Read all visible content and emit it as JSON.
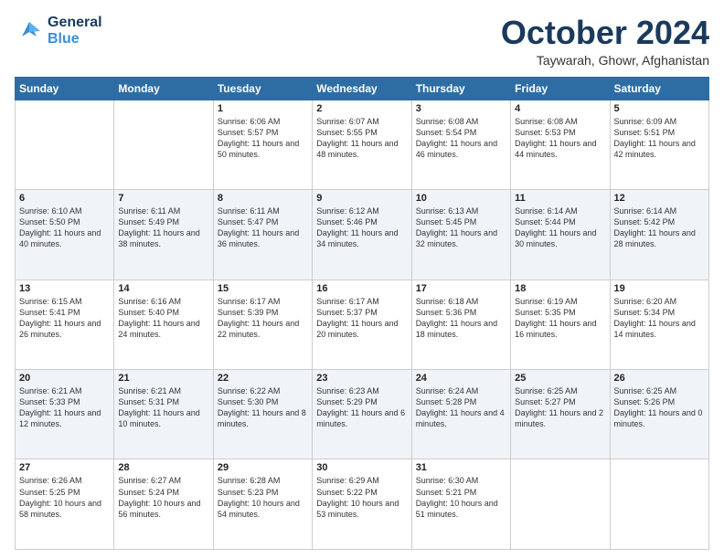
{
  "header": {
    "logo_line1": "General",
    "logo_line2": "Blue",
    "month_title": "October 2024",
    "location": "Taywarah, Ghowr, Afghanistan"
  },
  "days_of_week": [
    "Sunday",
    "Monday",
    "Tuesday",
    "Wednesday",
    "Thursday",
    "Friday",
    "Saturday"
  ],
  "weeks": [
    [
      {
        "day": "",
        "sunrise": "",
        "sunset": "",
        "daylight": ""
      },
      {
        "day": "",
        "sunrise": "",
        "sunset": "",
        "daylight": ""
      },
      {
        "day": "1",
        "sunrise": "Sunrise: 6:06 AM",
        "sunset": "Sunset: 5:57 PM",
        "daylight": "Daylight: 11 hours and 50 minutes."
      },
      {
        "day": "2",
        "sunrise": "Sunrise: 6:07 AM",
        "sunset": "Sunset: 5:55 PM",
        "daylight": "Daylight: 11 hours and 48 minutes."
      },
      {
        "day": "3",
        "sunrise": "Sunrise: 6:08 AM",
        "sunset": "Sunset: 5:54 PM",
        "daylight": "Daylight: 11 hours and 46 minutes."
      },
      {
        "day": "4",
        "sunrise": "Sunrise: 6:08 AM",
        "sunset": "Sunset: 5:53 PM",
        "daylight": "Daylight: 11 hours and 44 minutes."
      },
      {
        "day": "5",
        "sunrise": "Sunrise: 6:09 AM",
        "sunset": "Sunset: 5:51 PM",
        "daylight": "Daylight: 11 hours and 42 minutes."
      }
    ],
    [
      {
        "day": "6",
        "sunrise": "Sunrise: 6:10 AM",
        "sunset": "Sunset: 5:50 PM",
        "daylight": "Daylight: 11 hours and 40 minutes."
      },
      {
        "day": "7",
        "sunrise": "Sunrise: 6:11 AM",
        "sunset": "Sunset: 5:49 PM",
        "daylight": "Daylight: 11 hours and 38 minutes."
      },
      {
        "day": "8",
        "sunrise": "Sunrise: 6:11 AM",
        "sunset": "Sunset: 5:47 PM",
        "daylight": "Daylight: 11 hours and 36 minutes."
      },
      {
        "day": "9",
        "sunrise": "Sunrise: 6:12 AM",
        "sunset": "Sunset: 5:46 PM",
        "daylight": "Daylight: 11 hours and 34 minutes."
      },
      {
        "day": "10",
        "sunrise": "Sunrise: 6:13 AM",
        "sunset": "Sunset: 5:45 PM",
        "daylight": "Daylight: 11 hours and 32 minutes."
      },
      {
        "day": "11",
        "sunrise": "Sunrise: 6:14 AM",
        "sunset": "Sunset: 5:44 PM",
        "daylight": "Daylight: 11 hours and 30 minutes."
      },
      {
        "day": "12",
        "sunrise": "Sunrise: 6:14 AM",
        "sunset": "Sunset: 5:42 PM",
        "daylight": "Daylight: 11 hours and 28 minutes."
      }
    ],
    [
      {
        "day": "13",
        "sunrise": "Sunrise: 6:15 AM",
        "sunset": "Sunset: 5:41 PM",
        "daylight": "Daylight: 11 hours and 26 minutes."
      },
      {
        "day": "14",
        "sunrise": "Sunrise: 6:16 AM",
        "sunset": "Sunset: 5:40 PM",
        "daylight": "Daylight: 11 hours and 24 minutes."
      },
      {
        "day": "15",
        "sunrise": "Sunrise: 6:17 AM",
        "sunset": "Sunset: 5:39 PM",
        "daylight": "Daylight: 11 hours and 22 minutes."
      },
      {
        "day": "16",
        "sunrise": "Sunrise: 6:17 AM",
        "sunset": "Sunset: 5:37 PM",
        "daylight": "Daylight: 11 hours and 20 minutes."
      },
      {
        "day": "17",
        "sunrise": "Sunrise: 6:18 AM",
        "sunset": "Sunset: 5:36 PM",
        "daylight": "Daylight: 11 hours and 18 minutes."
      },
      {
        "day": "18",
        "sunrise": "Sunrise: 6:19 AM",
        "sunset": "Sunset: 5:35 PM",
        "daylight": "Daylight: 11 hours and 16 minutes."
      },
      {
        "day": "19",
        "sunrise": "Sunrise: 6:20 AM",
        "sunset": "Sunset: 5:34 PM",
        "daylight": "Daylight: 11 hours and 14 minutes."
      }
    ],
    [
      {
        "day": "20",
        "sunrise": "Sunrise: 6:21 AM",
        "sunset": "Sunset: 5:33 PM",
        "daylight": "Daylight: 11 hours and 12 minutes."
      },
      {
        "day": "21",
        "sunrise": "Sunrise: 6:21 AM",
        "sunset": "Sunset: 5:31 PM",
        "daylight": "Daylight: 11 hours and 10 minutes."
      },
      {
        "day": "22",
        "sunrise": "Sunrise: 6:22 AM",
        "sunset": "Sunset: 5:30 PM",
        "daylight": "Daylight: 11 hours and 8 minutes."
      },
      {
        "day": "23",
        "sunrise": "Sunrise: 6:23 AM",
        "sunset": "Sunset: 5:29 PM",
        "daylight": "Daylight: 11 hours and 6 minutes."
      },
      {
        "day": "24",
        "sunrise": "Sunrise: 6:24 AM",
        "sunset": "Sunset: 5:28 PM",
        "daylight": "Daylight: 11 hours and 4 minutes."
      },
      {
        "day": "25",
        "sunrise": "Sunrise: 6:25 AM",
        "sunset": "Sunset: 5:27 PM",
        "daylight": "Daylight: 11 hours and 2 minutes."
      },
      {
        "day": "26",
        "sunrise": "Sunrise: 6:25 AM",
        "sunset": "Sunset: 5:26 PM",
        "daylight": "Daylight: 11 hours and 0 minutes."
      }
    ],
    [
      {
        "day": "27",
        "sunrise": "Sunrise: 6:26 AM",
        "sunset": "Sunset: 5:25 PM",
        "daylight": "Daylight: 10 hours and 58 minutes."
      },
      {
        "day": "28",
        "sunrise": "Sunrise: 6:27 AM",
        "sunset": "Sunset: 5:24 PM",
        "daylight": "Daylight: 10 hours and 56 minutes."
      },
      {
        "day": "29",
        "sunrise": "Sunrise: 6:28 AM",
        "sunset": "Sunset: 5:23 PM",
        "daylight": "Daylight: 10 hours and 54 minutes."
      },
      {
        "day": "30",
        "sunrise": "Sunrise: 6:29 AM",
        "sunset": "Sunset: 5:22 PM",
        "daylight": "Daylight: 10 hours and 53 minutes."
      },
      {
        "day": "31",
        "sunrise": "Sunrise: 6:30 AM",
        "sunset": "Sunset: 5:21 PM",
        "daylight": "Daylight: 10 hours and 51 minutes."
      },
      {
        "day": "",
        "sunrise": "",
        "sunset": "",
        "daylight": ""
      },
      {
        "day": "",
        "sunrise": "",
        "sunset": "",
        "daylight": ""
      }
    ]
  ]
}
